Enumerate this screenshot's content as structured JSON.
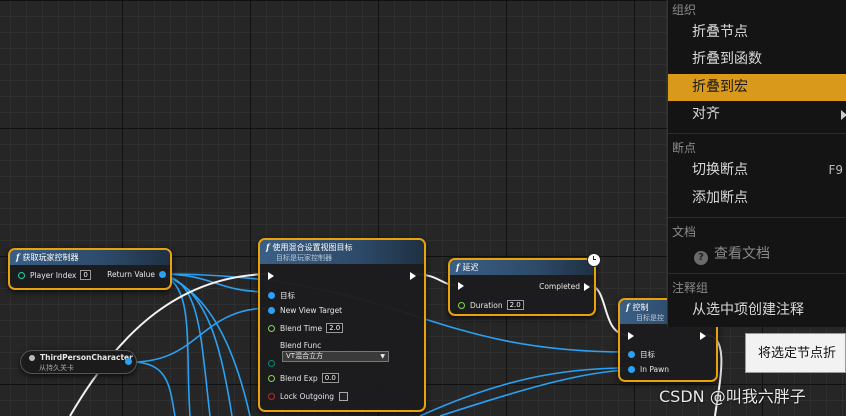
{
  "nodes": {
    "get_controller": {
      "title": "获取玩家控制器",
      "player_index_label": "Player Index",
      "player_index_value": "0",
      "return_value_label": "Return Value"
    },
    "third_person": {
      "title": "ThirdPersonCharacter",
      "subtitle": "从持久关卡"
    },
    "set_view_target": {
      "title": "使用混合设置视图目标",
      "subtitle": "目标是玩家控制器",
      "target_label": "目标",
      "new_view_target_label": "New View Target",
      "blend_time_label": "Blend Time",
      "blend_time_value": "2.0",
      "blend_func_label": "Blend Func",
      "blend_func_value": "VT混合立方",
      "blend_exp_label": "Blend Exp",
      "blend_exp_value": "0.0",
      "lock_outgoing_label": "Lock Outgoing"
    },
    "delay": {
      "title": "延迟",
      "completed_label": "Completed",
      "duration_label": "Duration",
      "duration_value": "2.0"
    },
    "possess": {
      "title": "控制",
      "subtitle": "目标是控",
      "target_label": "目标",
      "in_pawn_label": "In Pawn"
    }
  },
  "context_menu": {
    "section_organize": "组织",
    "collapse_nodes": "折叠节点",
    "collapse_to_function": "折叠到函数",
    "collapse_to_macro": "折叠到宏",
    "align": "对齐",
    "section_breakpoints": "断点",
    "toggle_breakpoint": "切换断点",
    "toggle_breakpoint_shortcut": "F9",
    "add_breakpoint": "添加断点",
    "section_docs": "文档",
    "view_docs": "查看文档",
    "section_comment": "注释组",
    "create_comment": "从选中项创建注释"
  },
  "tooltip": "将选定节点折",
  "watermark": "CSDN @叫我六胖子",
  "colors": {
    "selection_orange": "#e8a20c",
    "menu_highlight": "#d99a1c",
    "object_pin_blue": "#2aa1f4",
    "float_pin_green": "#7ed957",
    "exec_white": "#ffffff"
  }
}
